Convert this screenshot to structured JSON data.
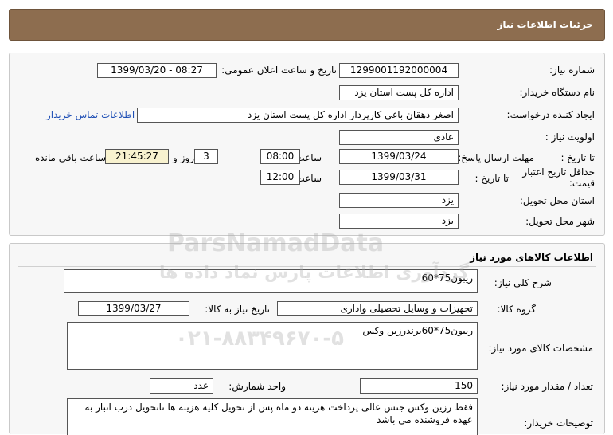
{
  "header": {
    "title": "جزئیات اطلاعات نیاز"
  },
  "need_info": {
    "need_number_label": "شماره نیاز:",
    "need_number": "1299001192000004",
    "announce_label": "تاریخ و ساعت اعلان عمومی:",
    "announce_value": "1399/03/20 - 08:27",
    "buyer_org_label": "نام دستگاه خریدار:",
    "buyer_org": "اداره کل پست استان یزد",
    "requester_label": "ایجاد کننده درخواست:",
    "requester": "اصغر دهقان باغی کارپرداز  اداره کل پست استان یزد",
    "contact_link": "اطلاعات تماس خریدار",
    "priority_label": "اولویت نیاز :",
    "priority": "عادی",
    "deadline_label": "مهلت ارسال پاسخ:",
    "until_date_label": "تا تاریخ :",
    "deadline_date": "1399/03/24",
    "time_label": "ساعت",
    "deadline_time": "08:00",
    "days_value": "3",
    "days_label": "روز و",
    "remaining_time": "21:45:27",
    "remaining_label": "ساعت باقی مانده",
    "validity_label": "حداقل تاریخ اعتبار قیمت:",
    "validity_until_label": "تا تاریخ :",
    "validity_date": "1399/03/31",
    "validity_time_label": "ساعت",
    "validity_time": "12:00",
    "province_label": "استان محل تحویل:",
    "province": "یزد",
    "city_label": "شهر محل تحویل:",
    "city": "یزد"
  },
  "goods": {
    "section_title": "اطلاعات کالاهای مورد نیاز",
    "desc_label": "شرح کلی نیاز:",
    "desc": "ریبون75*60",
    "group_label": "گروه کالا:",
    "group": "تجهیزات و وسایل تحصیلی واداری",
    "need_date_label": "تاریخ نیاز به کالا:",
    "need_date": "1399/03/27",
    "specs_label": "مشخصات کالای مورد نیاز:",
    "specs": "ریبون75*60برندرزین وکس",
    "qty_label": "تعداد / مقدار مورد نیاز:",
    "qty": "150",
    "unit_label": "واحد شمارش:",
    "unit": "عدد",
    "buyer_notes_label": "توضیحات خریدار:",
    "buyer_notes": "فقط رزین وکس جنس عالی پرداخت هزینه دو ماه پس از تحویل کلیه هزینه ها تاتحویل درب انبار به عهده فروشنده می باشد"
  },
  "watermark": {
    "brand": "ParsNamadData",
    "slogan": "گردآوری اطلاعات پارس نماد داده ها",
    "phone": "۰۲۱-۸۸۳۴۹۶۷۰-۵"
  }
}
